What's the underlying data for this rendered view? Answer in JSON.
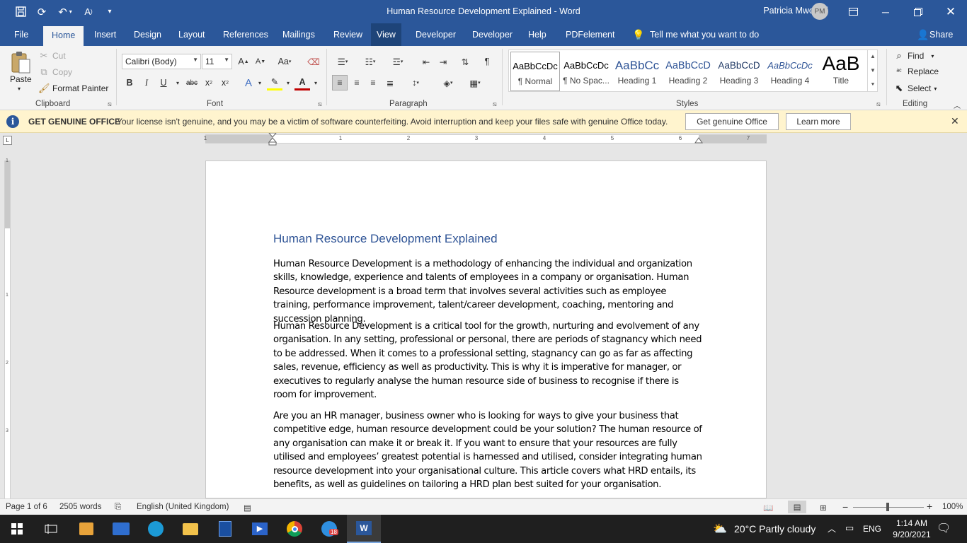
{
  "titlebar": {
    "title": "Human Resource Development Explained  -  Word",
    "user": "Patricia Mworozi",
    "initials": "PM"
  },
  "tabs": [
    {
      "label": "File"
    },
    {
      "label": "Home"
    },
    {
      "label": "Insert"
    },
    {
      "label": "Design"
    },
    {
      "label": "Layout"
    },
    {
      "label": "References"
    },
    {
      "label": "Mailings"
    },
    {
      "label": "Review"
    },
    {
      "label": "View"
    },
    {
      "label": "Developer"
    },
    {
      "label": "Developer"
    },
    {
      "label": "Help"
    },
    {
      "label": "PDFelement"
    }
  ],
  "tell_me": "Tell me what you want to do",
  "share": "Share",
  "clipboard": {
    "paste": "Paste",
    "cut": "Cut",
    "copy": "Copy",
    "format_painter": "Format Painter",
    "group": "Clipboard"
  },
  "font": {
    "name": "Calibri (Body)",
    "size": "11",
    "group": "Font"
  },
  "paragraph": {
    "group": "Paragraph"
  },
  "styles": {
    "group": "Styles",
    "items": [
      {
        "preview": "AaBbCcDc",
        "name": "¶ Normal"
      },
      {
        "preview": "AaBbCcDc",
        "name": "¶ No Spac..."
      },
      {
        "preview": "AaBbCc",
        "name": "Heading 1"
      },
      {
        "preview": "AaBbCcD",
        "name": "Heading 2"
      },
      {
        "preview": "AaBbCcD",
        "name": "Heading 3"
      },
      {
        "preview": "AaBbCcDc",
        "name": "Heading 4"
      },
      {
        "preview": "AaB",
        "name": "Title"
      }
    ]
  },
  "editing": {
    "find": "Find",
    "replace": "Replace",
    "select": "Select",
    "group": "Editing"
  },
  "banner": {
    "head": "GET GENUINE OFFICE",
    "message": "Your license isn't genuine, and you may be a victim of software counterfeiting. Avoid interruption and keep your files safe with genuine Office today.",
    "get_button": "Get genuine Office",
    "learn_button": "Learn more"
  },
  "ruler": {
    "h_numbers": [
      "1",
      "1",
      "2",
      "3",
      "4",
      "5",
      "6",
      "7"
    ],
    "v_numbers": [
      "1",
      "1",
      "2",
      "3"
    ]
  },
  "document": {
    "title": "Human Resource Development Explained",
    "paragraphs": [
      "Human Resource Development is a methodology of enhancing the individual and organization skills, knowledge, experience and talents of employees in a company or organisation. Human Resource development is a broad term that involves several activities such as employee training, performance improvement, talent/career development, coaching, mentoring and succession planning.",
      "Human Resource Development is a critical tool for the growth, nurturing and evolvement of any organisation. In any setting, professional or personal, there are periods of stagnancy which need to be addressed. When it comes to a professional setting, stagnancy can go as far as affecting sales, revenue, efficiency as well as productivity. This is why it is imperative for manager, or executives to regularly analyse the human resource side of business to recognise if there is room for improvement.",
      "Are you an HR manager, business owner who is looking for ways to give your business that competitive edge, human resource development could be your solution? The human resource of any organisation can make it or break it. If you want to ensure that your resources are fully utilised and employees’ greatest potential is harnessed and utilised, consider integrating human resource development into your organisational culture. This article covers what HRD entails, its benefits, as well as guidelines on tailoring a HRD plan best suited for your organisation."
    ]
  },
  "status": {
    "page": "Page 1 of 6",
    "words": "2505 words",
    "language": "English (United Kingdom)",
    "zoom_minus": "−",
    "zoom_plus": "+",
    "zoom": "100%"
  },
  "taskbar": {
    "weather": "20°C  Partly cloudy",
    "lang": "ENG",
    "time": "1:14 AM",
    "date": "9/20/2021",
    "badge": "18"
  },
  "colors": {
    "word_blue": "#2b579a",
    "heading_blue": "#2f5496",
    "banner_yellow": "#fff4ce"
  }
}
